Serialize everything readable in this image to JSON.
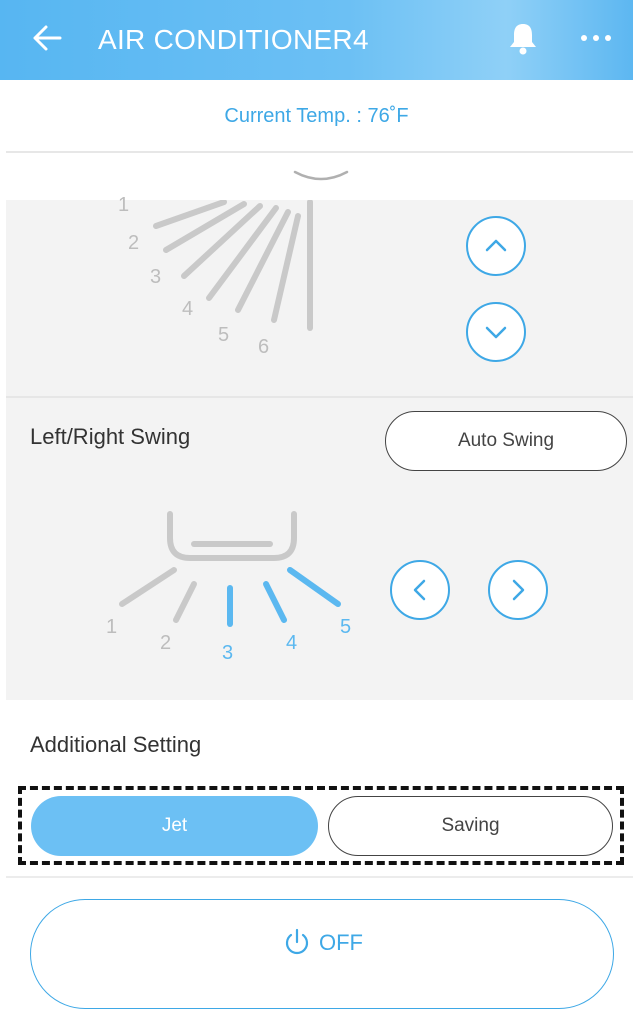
{
  "header": {
    "title": "AIR CONDITIONER4",
    "back_icon": "arrow-left-icon",
    "bell_icon": "bell-icon",
    "more_icon": "more-horizontal-icon"
  },
  "current_temp": "Current Temp. : 76˚F",
  "up_down_swing": {
    "visible_labels": [
      "1",
      "2",
      "3",
      "4",
      "5",
      "6"
    ],
    "up_icon": "chevron-up-icon",
    "down_icon": "chevron-down-icon"
  },
  "left_right_swing": {
    "title": "Left/Right Swing",
    "auto_swing_label": "Auto Swing",
    "labels": [
      "1",
      "2",
      "3",
      "4",
      "5"
    ],
    "active_positions": [
      "3",
      "4",
      "5"
    ],
    "left_icon": "chevron-left-icon",
    "right_icon": "chevron-right-icon"
  },
  "additional_setting": {
    "title": "Additional Setting",
    "options": [
      "Jet",
      "Saving"
    ],
    "selected": "Jet"
  },
  "power": {
    "label": "OFF",
    "icon": "power-icon"
  },
  "colors": {
    "accent": "#3ea8e6",
    "selected_fill": "#6cc0f4",
    "inactive": "#bdbdbd"
  }
}
